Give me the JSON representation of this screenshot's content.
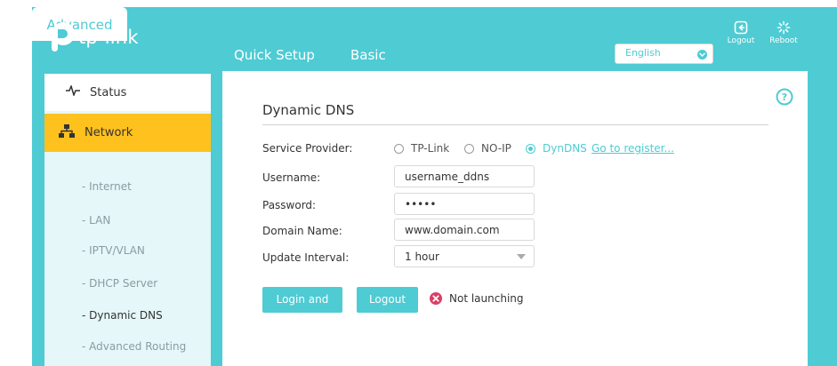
{
  "brand": {
    "name": "tp-link"
  },
  "nav": {
    "tabs": [
      {
        "label": "Quick Setup"
      },
      {
        "label": "Basic"
      },
      {
        "label": "Advanced"
      }
    ],
    "language": "English",
    "logout_label": "Logout",
    "reboot_label": "Reboot"
  },
  "sidebar": {
    "status": "Status",
    "network": "Network",
    "items": [
      {
        "label": "- Internet"
      },
      {
        "label": "- LAN"
      },
      {
        "label": "- IPTV/VLAN"
      },
      {
        "label": "- DHCP Server"
      },
      {
        "label": "- Dynamic DNS"
      },
      {
        "label": "- Advanced Routing"
      }
    ]
  },
  "main": {
    "title": "Dynamic DNS",
    "service_provider_label": "Service Provider:",
    "providers": [
      {
        "label": "TP-Link",
        "selected": false
      },
      {
        "label": "NO-IP",
        "selected": false
      },
      {
        "label": "DynDNS",
        "selected": true
      }
    ],
    "register_link": "Go to register...",
    "username_label": "Username:",
    "username_value": "username_ddns",
    "password_label": "Password:",
    "password_value": "•••••",
    "domain_label": "Domain Name:",
    "domain_value": "www.domain.com",
    "interval_label": "Update Interval:",
    "interval_value": "1 hour",
    "save_button": "Login and Save",
    "logout_button": "Logout",
    "status_text": "Not launching"
  },
  "colors": {
    "accent": "#4ecbd3",
    "highlight": "#ffc11e",
    "error": "#dc3e64"
  }
}
